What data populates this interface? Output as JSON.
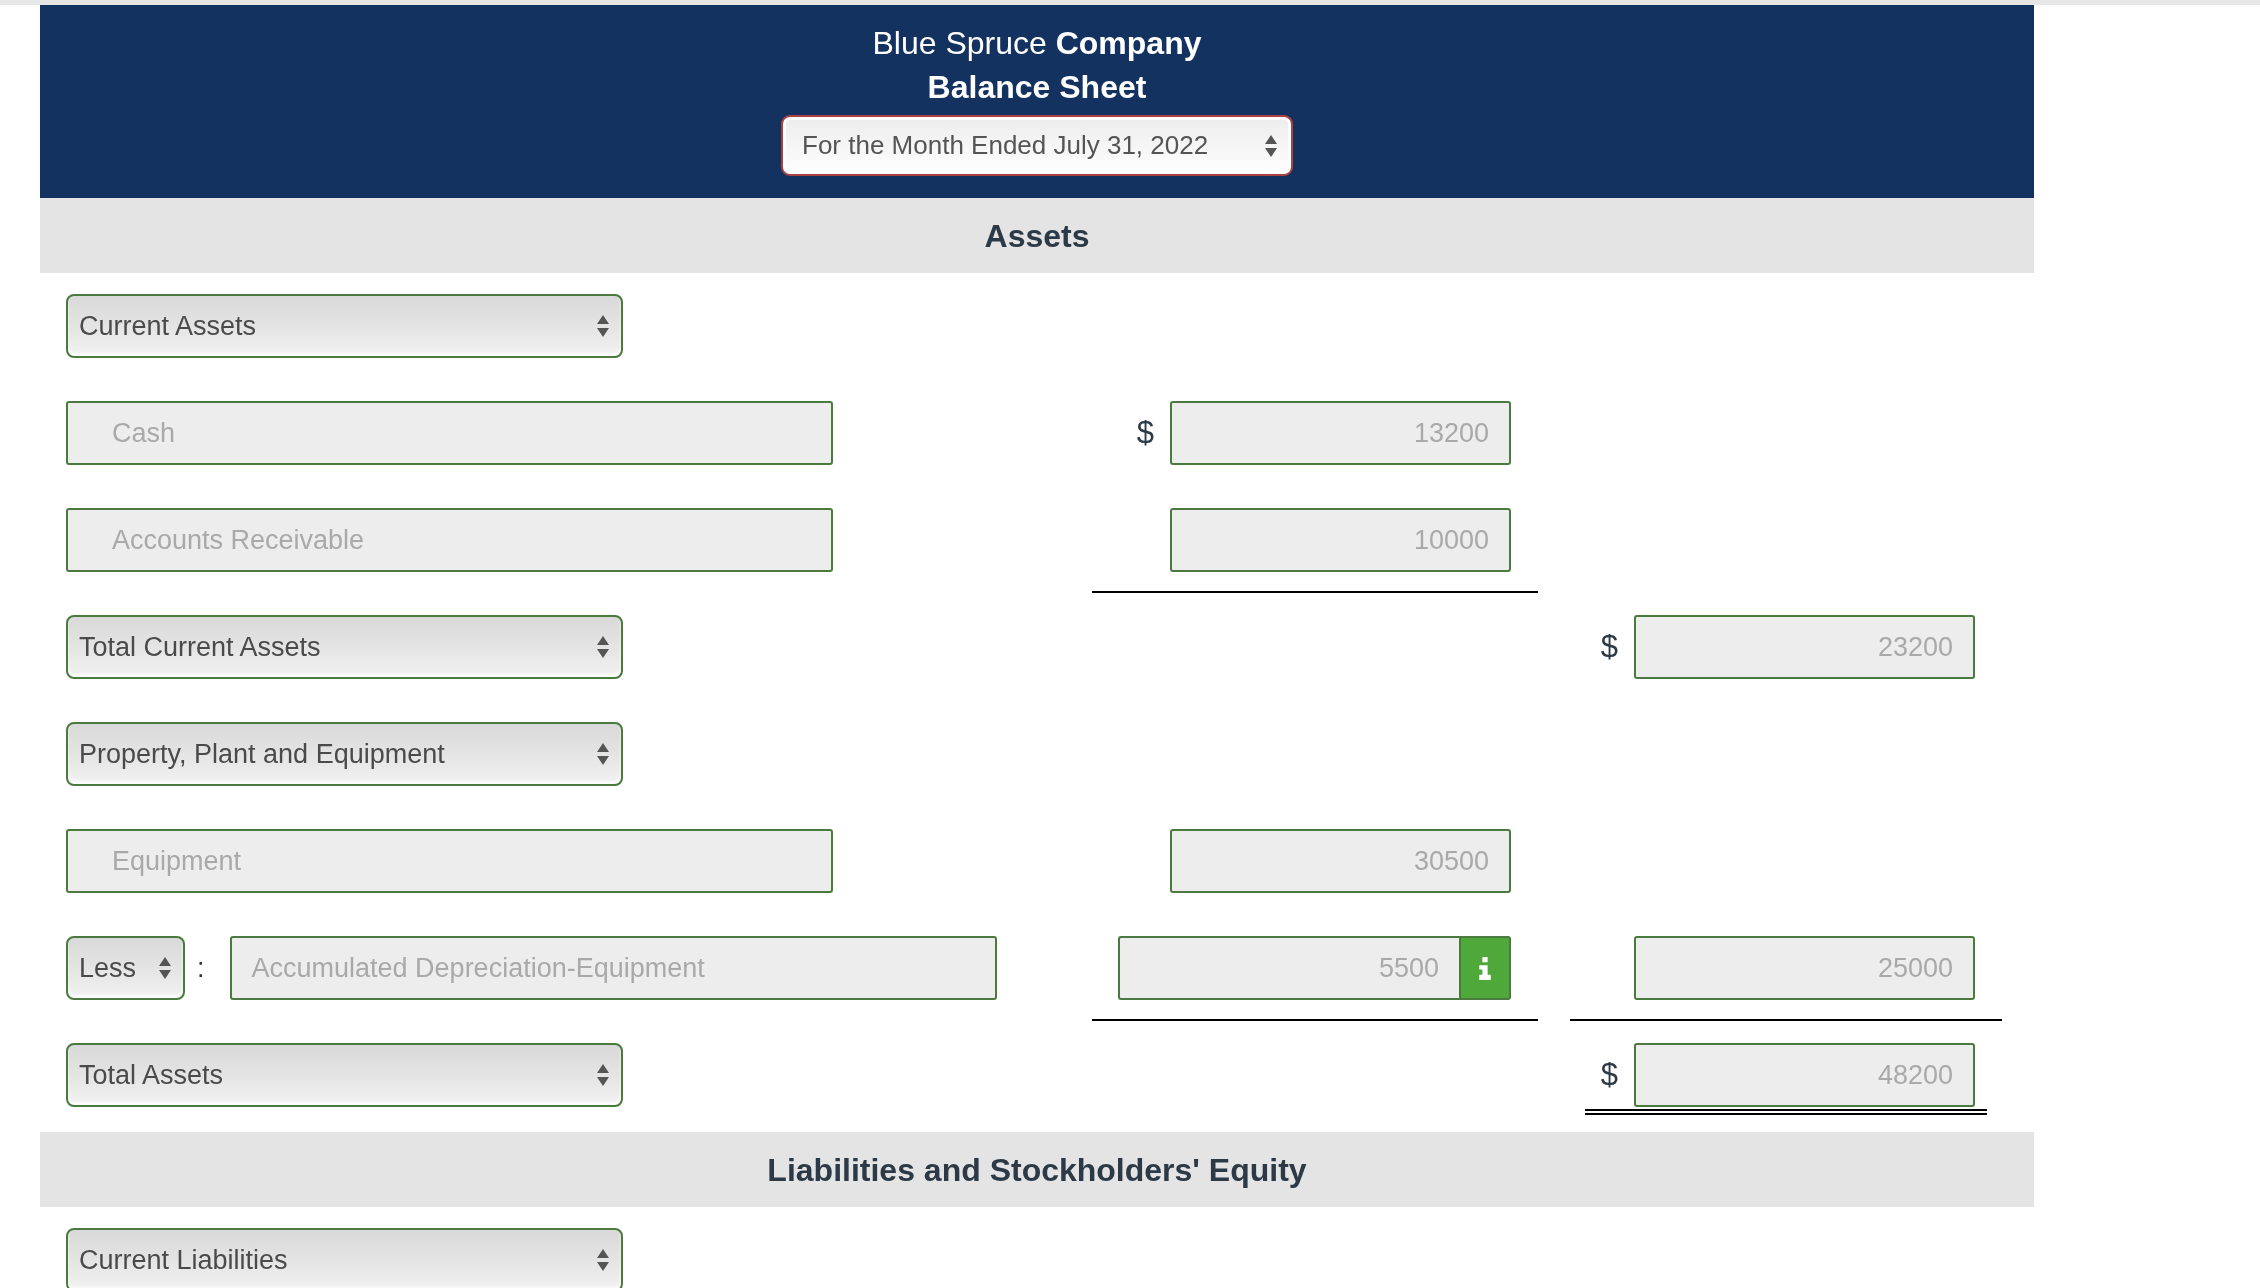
{
  "header": {
    "company": "Blue Spruce **Company**",
    "title": "Balance Sheet",
    "period": {
      "value": "For the Month Ended July 31, 2022",
      "correct": false
    }
  },
  "sections": [
    {
      "heading": "Assets",
      "rows": [
        {
          "kind": "select",
          "label": {
            "value": "Current Assets",
            "correct": true
          }
        },
        {
          "kind": "account",
          "account": {
            "value": "Cash",
            "correct": true,
            "disabled": true
          },
          "column_1": {
            "dollar": "$",
            "value": "13200",
            "correct": true,
            "disabled": true
          }
        },
        {
          "kind": "account",
          "account": {
            "value": "Accounts Receivable",
            "correct": true,
            "disabled": true
          },
          "column_1": {
            "value": "10000",
            "correct": true,
            "disabled": true,
            "underlined": true
          }
        },
        {
          "kind": "select",
          "label": {
            "value": "Total Current Assets",
            "correct": true
          },
          "column_2": {
            "dollar": "$",
            "value": "23200",
            "correct": true,
            "disabled": true
          }
        },
        {
          "kind": "select",
          "label": {
            "value": "Property, Plant and Equipment",
            "correct": true
          }
        },
        {
          "kind": "account",
          "account": {
            "value": "Equipment",
            "correct": true,
            "disabled": true
          },
          "column_1": {
            "value": "30500",
            "correct": true,
            "disabled": true
          }
        },
        {
          "kind": "contra",
          "operator": {
            "value": "Less",
            "correct": true
          },
          "separator": ":",
          "account": {
            "value": "Accumulated Depreciation-Equipment",
            "correct": true,
            "disabled": true
          },
          "column_1": {
            "value": "5500",
            "correct": true,
            "disabled": true,
            "info": true,
            "underlined": true
          },
          "column_2": {
            "value": "25000",
            "correct": true,
            "disabled": true,
            "underlined": true
          }
        },
        {
          "kind": "select",
          "label": {
            "value": "Total Assets",
            "correct": true
          },
          "column_2": {
            "dollar": "$",
            "value": "48200",
            "correct": true,
            "disabled": true,
            "double_underlined": true
          }
        }
      ]
    },
    {
      "heading": "Liabilities and Stockholders' Equity",
      "rows": [
        {
          "kind": "select",
          "label": {
            "value": "Current Liabilities",
            "correct": true
          }
        }
      ]
    }
  ]
}
